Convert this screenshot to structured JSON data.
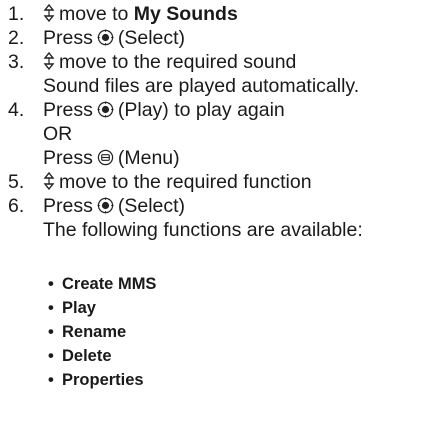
{
  "steps": [
    {
      "number": "1.",
      "prefix": "",
      "text": "move to ",
      "bold": "My Sounds"
    },
    {
      "number": "2.",
      "prefix": "Press",
      "text": "(Select)"
    },
    {
      "number": "3.",
      "text": "move to the required sound"
    },
    {
      "number": "",
      "text": "Sound files are played automatically."
    },
    {
      "number": "4.",
      "prefix": "Press",
      "text": "(Play) to play again"
    },
    {
      "number": "",
      "text": "OR"
    },
    {
      "number": "",
      "prefix": "Press",
      "text": "(Menu)"
    },
    {
      "number": "5.",
      "text": "move to the required function"
    },
    {
      "number": "6.",
      "prefix": "Press",
      "text": "(Select)"
    },
    {
      "number": "",
      "text": "The following functions are available:"
    }
  ],
  "functions": [
    "Create MMS",
    "Play",
    "Rename",
    "Delete",
    "Properties"
  ],
  "bullet_char": "•",
  "icons": {
    "navigation": "up-down-navigation-key-icon",
    "select": "select-center-key-icon",
    "menu": "menu-key-icon"
  }
}
